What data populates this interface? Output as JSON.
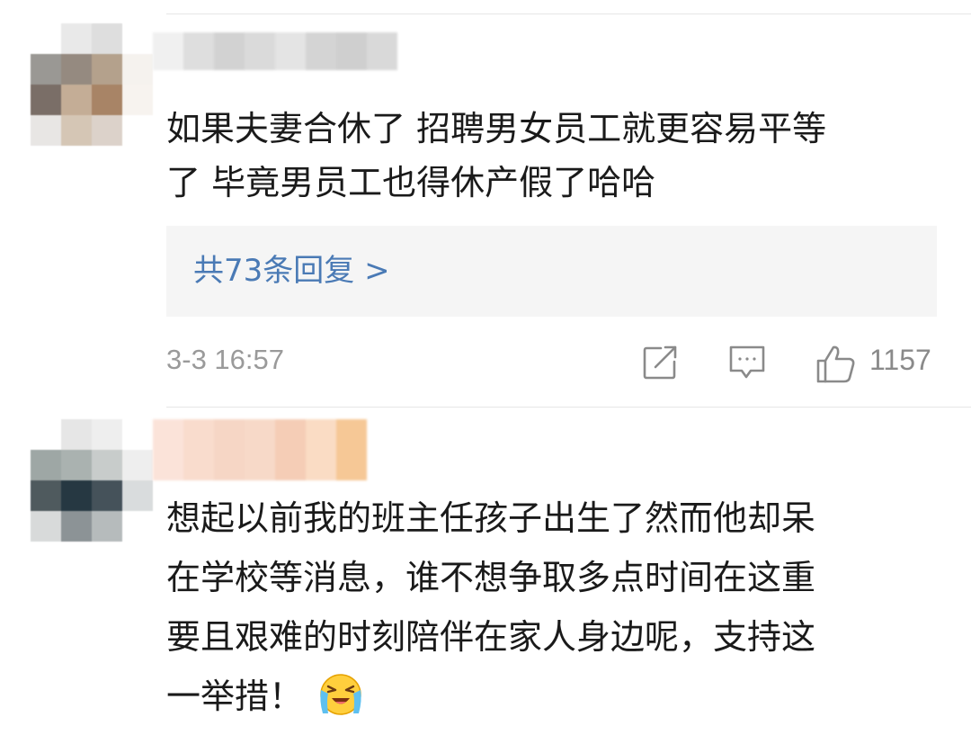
{
  "comments": [
    {
      "text_line1": "如果夫妻合休了 招聘男女员工就更容易平等",
      "text_line2": "了 毕竟男员工也得休产假了哈哈",
      "replies_label": "共73条回复 >",
      "timestamp": "3-3 16:57",
      "like_count": "1157",
      "avatar_colors": [
        [
          "#ffffff",
          "#e9e9e9",
          "#dedede",
          "#ffffff"
        ],
        [
          "#9a9894",
          "#958a80",
          "#b4a18c",
          "#f5f2ee"
        ],
        [
          "#7a6e67",
          "#c4ad96",
          "#a88466",
          "#f7f3ef"
        ],
        [
          "#e8e6e4",
          "#d5c6b5",
          "#dcd2ca",
          "#ffffff"
        ]
      ],
      "username_colors": [
        "#f0f0f0",
        "#dedede",
        "#d2d2d2",
        "#dadada",
        "#e4e4e4",
        "#d4d4d4",
        "#cfcfcf",
        "#d9d9d9"
      ]
    },
    {
      "text_line1": "想起以前我的班主任孩子出生了然而他却呆",
      "text_line2": "在学校等消息，谁不想争取多点时间在这重",
      "text_line3": "要且艰难的时刻陪伴在家人身边呢，支持这",
      "text_line4": "一举措！",
      "emoji": "crying-laughing-emoji",
      "avatar_colors": [
        [
          "#ffffff",
          "#e6e6e6",
          "#eeeeee",
          "#ffffff"
        ],
        [
          "#9ea7a5",
          "#aab2b0",
          "#c8cccb",
          "#eeeeee"
        ],
        [
          "#4f5a5e",
          "#263842",
          "#45525a",
          "#d9dcdd"
        ],
        [
          "#d8dada",
          "#8c9396",
          "#b6bbbc",
          "#ffffff"
        ]
      ],
      "username_colors": [
        "#fbe3d9",
        "#f9dccd",
        "#f6d6c5",
        "#f7d9c8",
        "#f5cdb6",
        "#fadcc4",
        "#f6c896"
      ]
    }
  ],
  "colors": {
    "link": "#4a7ab5",
    "meta": "#9a9a9a",
    "reply_bg": "#f5f5f5",
    "divider": "#e6e6e6"
  },
  "icons": [
    "share-icon",
    "comment-icon",
    "like-icon"
  ]
}
